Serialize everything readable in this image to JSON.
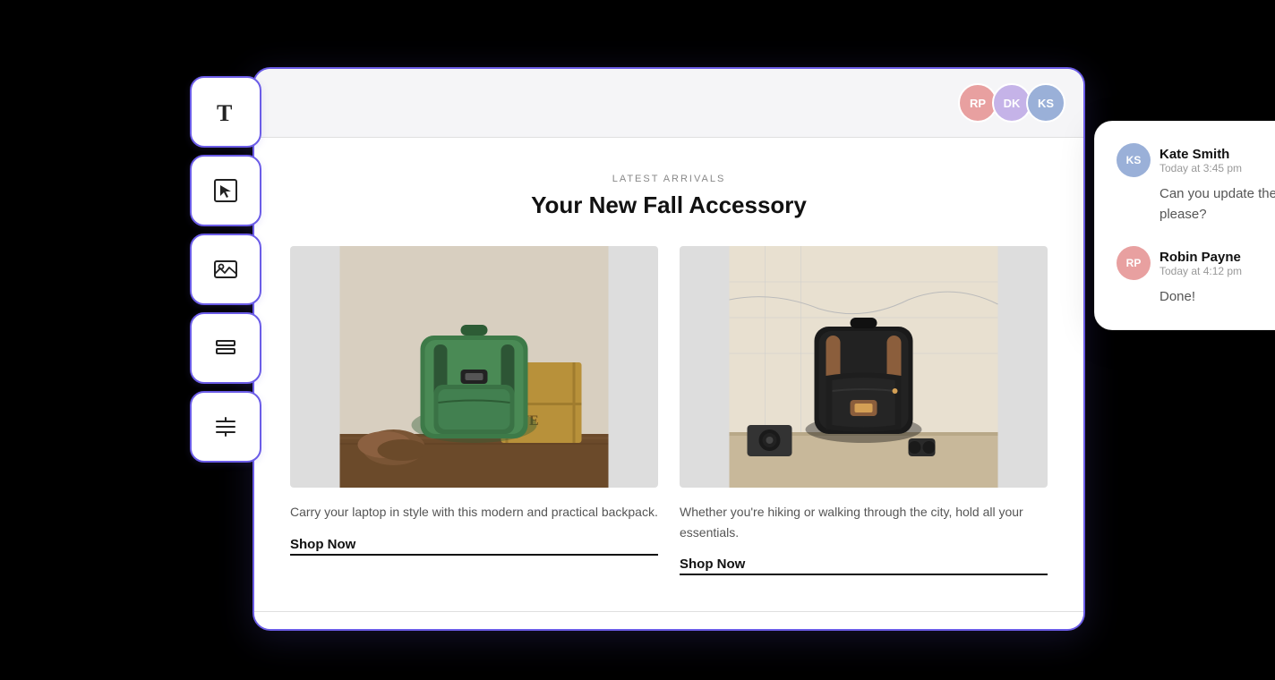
{
  "toolbar": {
    "buttons": [
      {
        "id": "text-tool",
        "icon": "text",
        "label": "Text Tool"
      },
      {
        "id": "select-tool",
        "icon": "select",
        "label": "Select Tool"
      },
      {
        "id": "image-tool",
        "icon": "image",
        "label": "Image Tool"
      },
      {
        "id": "layout-tool",
        "icon": "layout",
        "label": "Layout Tool"
      },
      {
        "id": "align-tool",
        "icon": "align",
        "label": "Align Tool"
      }
    ]
  },
  "editor": {
    "header": {
      "avatars": [
        {
          "id": "rp",
          "initials": "RP",
          "name": "Robin Payne",
          "color": "avatar-rp"
        },
        {
          "id": "dk",
          "initials": "DK",
          "name": "DK",
          "color": "avatar-dk"
        },
        {
          "id": "ks",
          "initials": "KS",
          "name": "Kate Smith",
          "color": "avatar-ks"
        }
      ]
    },
    "content": {
      "section_label": "LATEST ARRIVALS",
      "section_title": "Your New Fall Accessory",
      "products": [
        {
          "id": "product-1",
          "description": "Carry your laptop in style with this modern and practical backpack.",
          "shop_now_label": "Shop Now"
        },
        {
          "id": "product-2",
          "description": "Whether you're hiking or walking through the city, hold all your essentials.",
          "shop_now_label": "Shop Now"
        }
      ]
    }
  },
  "chat": {
    "messages": [
      {
        "id": "msg-1",
        "avatar_initials": "KS",
        "avatar_class": "chat-ks",
        "sender": "Kate Smith",
        "time": "Today at 3:45 pm",
        "text": "Can you update the wording please?"
      },
      {
        "id": "msg-2",
        "avatar_initials": "RP",
        "avatar_class": "chat-rp",
        "sender": "Robin Payne",
        "time": "Today at 4:12 pm",
        "text": "Done!"
      }
    ]
  }
}
